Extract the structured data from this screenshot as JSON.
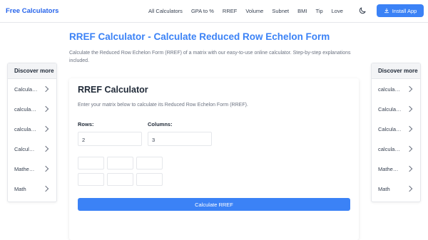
{
  "header": {
    "brand": "Free Calculators",
    "nav": [
      "All Calculators",
      "GPA to %",
      "RREF",
      "Volume",
      "Subnet",
      "BMI",
      "Tip",
      "Love"
    ],
    "install_label": "Install App",
    "accent": "#3b82f6",
    "theme_icon": "moon-icon",
    "install_icon": "download-icon"
  },
  "page": {
    "title": "RREF Calculator - Calculate Reduced Row Echelon Form",
    "description": "Calculate the Reduced Row Echelon Form (RREF) of a matrix with our easy-to-use online calculator. Step-by-step explanations included."
  },
  "left_sidebar": {
    "heading": "Discover more",
    "items": [
      "Calcula…",
      "calcula…",
      "calcula…",
      "Calcul…",
      "Mathe…",
      "Math"
    ]
  },
  "right_sidebar": {
    "heading": "Discover more",
    "items": [
      "calcula…",
      "Calcula…",
      "Calcula…",
      "calcula…",
      "Mathe…",
      "Math"
    ]
  },
  "calculator": {
    "title": "RREF Calculator",
    "description": "Enter your matrix below to calculate its Reduced Row Echelon Form (RREF).",
    "rows_label": "Rows:",
    "rows_value": "2",
    "columns_label": "Columns:",
    "columns_value": "3",
    "matrix": [
      [
        "",
        "",
        ""
      ],
      [
        "",
        "",
        ""
      ]
    ],
    "button_label": "Calculate RREF"
  }
}
